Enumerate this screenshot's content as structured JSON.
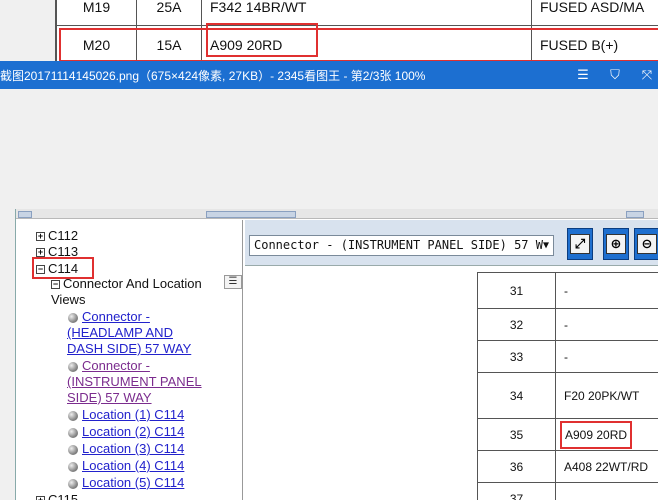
{
  "top_table": {
    "rows": [
      {
        "pin": "M19",
        "fuse": "25A",
        "circuit": "F342 14BR/WT",
        "function": "FUSED ASD/MA"
      },
      {
        "pin": "M20",
        "fuse": "15A",
        "circuit": "A909 20RD",
        "function": "FUSED B(+)"
      }
    ]
  },
  "viewer": {
    "title": "截图20171114145026.png（675×424像素, 27KB）- 2345看图王 - 第2/3张 100%",
    "icons": [
      "menu-icon",
      "shirt-icon",
      "fullscreen-icon"
    ]
  },
  "tree": {
    "items": [
      {
        "label": "C112",
        "type": "collapsed"
      },
      {
        "label": "C113",
        "type": "collapsed"
      },
      {
        "label": "C114",
        "type": "expanded"
      },
      {
        "label": "Connector And Location",
        "label2": "Views",
        "type": "expanded-child"
      },
      {
        "label": "Connector -",
        "label2": "(HEADLAMP AND",
        "label3": "DASH SIDE) 57 WAY",
        "type": "link"
      },
      {
        "label": "Connector -",
        "label2": "(INSTRUMENT PANEL",
        "label3": "SIDE) 57 WAY",
        "type": "visited"
      },
      {
        "label": "Location (1) C114",
        "type": "link"
      },
      {
        "label": "Location (2) C114",
        "type": "link"
      },
      {
        "label": "Location (3) C114",
        "type": "link"
      },
      {
        "label": "Location (4) C114",
        "type": "link"
      },
      {
        "label": "Location (5) C114",
        "type": "link"
      },
      {
        "label": "C115",
        "type": "collapsed"
      }
    ]
  },
  "toolbar": {
    "select_value": "Connector - (INSTRUMENT PANEL SIDE) 57 W"
  },
  "pin_table": {
    "rows": [
      {
        "pin": "31",
        "circuit": "-"
      },
      {
        "pin": "32",
        "circuit": "-"
      },
      {
        "pin": "33",
        "circuit": "-"
      },
      {
        "pin": "34",
        "circuit": "F20 20PK/WT"
      },
      {
        "pin": "35",
        "circuit": "A909 20RD"
      },
      {
        "pin": "36",
        "circuit": "A408 22WT/RD"
      },
      {
        "pin": "37",
        "circuit": ""
      }
    ]
  },
  "colors": {
    "highlight": "#e03030",
    "title_bar": "#1c6fd1",
    "link": "#2222cc",
    "visited_link": "#7b2c8e"
  }
}
